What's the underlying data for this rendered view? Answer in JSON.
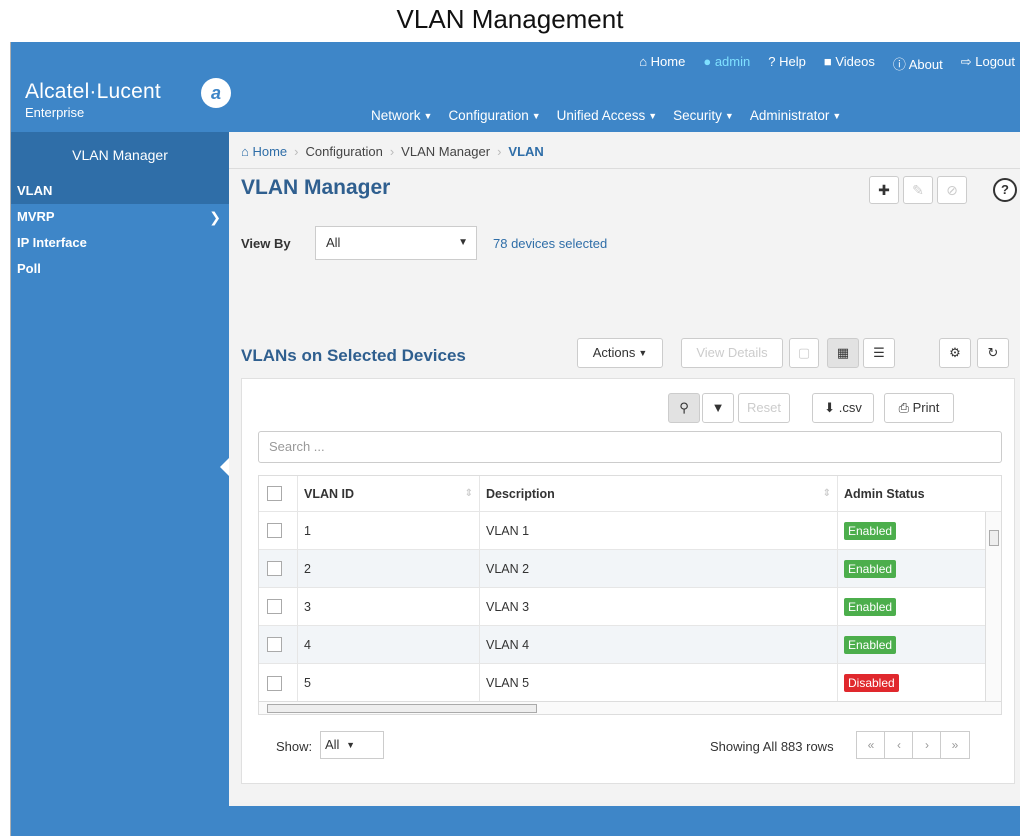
{
  "caption": "VLAN Management",
  "brand": {
    "name": "Alcatel·Lucent",
    "sub": "Enterprise"
  },
  "toplinks": [
    {
      "icon": "home-icon",
      "label": "Home"
    },
    {
      "icon": "user-icon",
      "label": "admin"
    },
    {
      "icon": "help-icon",
      "label": "Help"
    },
    {
      "icon": "video-icon",
      "label": "Videos"
    },
    {
      "icon": "info-icon",
      "label": "About"
    },
    {
      "icon": "logout-icon",
      "label": "Logout"
    }
  ],
  "mainnav": [
    "Network",
    "Configuration",
    "Unified Access",
    "Security",
    "Administrator"
  ],
  "sidebar": {
    "title": "VLAN Manager",
    "items": [
      {
        "label": "VLAN",
        "active": true
      },
      {
        "label": "MVRP",
        "has_submenu": true
      },
      {
        "label": "IP Interface"
      },
      {
        "label": "Poll"
      }
    ]
  },
  "breadcrumb": [
    "Home",
    "Configuration",
    "VLAN Manager",
    "VLAN"
  ],
  "page_title": "VLAN Manager",
  "viewby": {
    "label": "View By",
    "value": "All",
    "devices": "78 devices selected"
  },
  "section_title": "VLANs on Selected Devices",
  "toolbar": {
    "actions": "Actions",
    "view_details": "View Details"
  },
  "table_tools": {
    "reset": "Reset",
    "csv": ".csv",
    "print": "Print"
  },
  "search": {
    "placeholder": "Search ..."
  },
  "table": {
    "columns": [
      "VLAN ID",
      "Description",
      "Admin Status"
    ],
    "rows": [
      {
        "id": "1",
        "desc": "VLAN 1",
        "status": "Enabled"
      },
      {
        "id": "2",
        "desc": "VLAN 2",
        "status": "Enabled"
      },
      {
        "id": "3",
        "desc": "VLAN 3",
        "status": "Enabled"
      },
      {
        "id": "4",
        "desc": "VLAN 4",
        "status": "Enabled"
      },
      {
        "id": "5",
        "desc": "VLAN 5",
        "status": "Disabled"
      }
    ]
  },
  "footer": {
    "show_label": "Show:",
    "show_value": "All",
    "rows_info": "Showing All 883 rows"
  },
  "colors": {
    "header_blue": "#3e86c8",
    "title_blue": "#2f5f8f",
    "enabled": "#4cae4c",
    "disabled": "#e0282d"
  }
}
